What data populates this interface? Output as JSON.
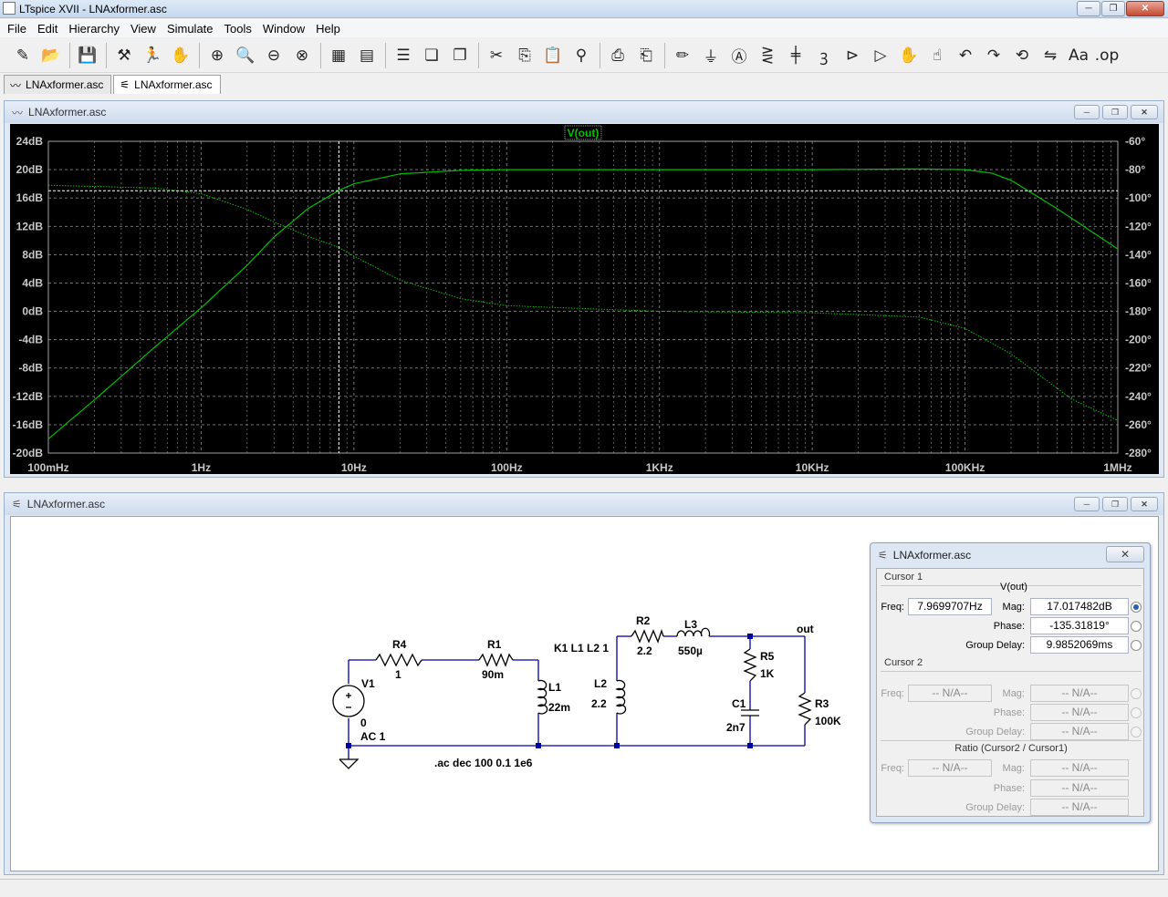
{
  "app": {
    "title": "LTspice XVII - LNAxformer.asc",
    "window_buttons": {
      "minimize": "─",
      "restore": "❐",
      "close": "✕"
    }
  },
  "menu": [
    "File",
    "Edit",
    "Hierarchy",
    "View",
    "Simulate",
    "Tools",
    "Window",
    "Help"
  ],
  "toolbar": [
    {
      "name": "new-schematic-icon",
      "glyph": "✎"
    },
    {
      "name": "open-icon",
      "glyph": "📂"
    },
    {
      "sep": true
    },
    {
      "name": "save-icon",
      "glyph": "💾"
    },
    {
      "sep": true
    },
    {
      "name": "control-panel-icon",
      "glyph": "⚒"
    },
    {
      "name": "run-icon",
      "glyph": "🏃"
    },
    {
      "name": "halt-icon",
      "glyph": "✋"
    },
    {
      "sep": true
    },
    {
      "name": "zoom-in-icon",
      "glyph": "⊕"
    },
    {
      "name": "pan-icon",
      "glyph": "🔍"
    },
    {
      "name": "zoom-out-icon",
      "glyph": "⊖"
    },
    {
      "name": "zoom-fit-icon",
      "glyph": "⊗"
    },
    {
      "sep": true
    },
    {
      "name": "autorange-icon",
      "glyph": "▦"
    },
    {
      "name": "plot-settings-icon",
      "glyph": "▤"
    },
    {
      "sep": true
    },
    {
      "name": "tile-horizontal-icon",
      "glyph": "☰"
    },
    {
      "name": "tile-vertical-icon",
      "glyph": "❏"
    },
    {
      "name": "cascade-icon",
      "glyph": "❐"
    },
    {
      "sep": true
    },
    {
      "name": "cut-icon",
      "glyph": "✂"
    },
    {
      "name": "copy-icon",
      "glyph": "⎘"
    },
    {
      "name": "paste-icon",
      "glyph": "📋"
    },
    {
      "name": "find-icon",
      "glyph": "⚲"
    },
    {
      "sep": true
    },
    {
      "name": "print-icon",
      "glyph": "⎙"
    },
    {
      "name": "print-preview-icon",
      "glyph": "⎗"
    },
    {
      "sep": true
    },
    {
      "name": "wire-icon",
      "glyph": "✏"
    },
    {
      "name": "ground-icon",
      "glyph": "⏚"
    },
    {
      "name": "label-net-icon",
      "glyph": "Ⓐ"
    },
    {
      "name": "resistor-icon",
      "glyph": "⋛"
    },
    {
      "name": "capacitor-icon",
      "glyph": "╪"
    },
    {
      "name": "inductor-icon",
      "glyph": "ꝫ"
    },
    {
      "name": "diode-icon",
      "glyph": "⊳"
    },
    {
      "name": "component-icon",
      "glyph": "▷"
    },
    {
      "name": "move-icon",
      "glyph": "✋"
    },
    {
      "name": "drag-icon",
      "glyph": "☝"
    },
    {
      "name": "undo-icon",
      "glyph": "↶"
    },
    {
      "name": "redo-icon",
      "glyph": "↷"
    },
    {
      "name": "rotate-icon",
      "glyph": "⟲"
    },
    {
      "name": "mirror-icon",
      "glyph": "⇋"
    },
    {
      "name": "text-icon",
      "glyph": "Aa"
    },
    {
      "name": "spice-directive-icon",
      "glyph": ".op"
    }
  ],
  "tabs": [
    {
      "label": "LNAxformer.asc",
      "icon": "waveform-icon",
      "glyph": "〰",
      "active": false
    },
    {
      "label": "LNAxformer.asc",
      "icon": "schematic-icon",
      "glyph": "⚟",
      "active": true
    }
  ],
  "plot_window": {
    "title": "LNAxformer.asc",
    "trace_label": "V(out)",
    "trace_color": "#00c000",
    "grid_color": "#808080",
    "cursor_color": "#ffffff"
  },
  "chart_data": {
    "type": "line",
    "title": "V(out)",
    "x_scale": "log",
    "xlim": [
      0.1,
      1000000
    ],
    "x_ticks": [
      "100mHz",
      "1Hz",
      "10Hz",
      "100Hz",
      "1KHz",
      "10KHz",
      "100KHz",
      "1MHz"
    ],
    "y_left_ticks": [
      "24dB",
      "20dB",
      "16dB",
      "12dB",
      "8dB",
      "4dB",
      "0dB",
      "-4dB",
      "-8dB",
      "-12dB",
      "-16dB",
      "-20dB"
    ],
    "y_right_ticks": [
      "-60°",
      "-80°",
      "-100°",
      "-120°",
      "-140°",
      "-160°",
      "-180°",
      "-200°",
      "-220°",
      "-240°",
      "-260°",
      "-280°"
    ],
    "ylim_left": [
      -20,
      24
    ],
    "ylim_right": [
      -280,
      -60
    ],
    "grid": true,
    "series": [
      {
        "name": "V(out)",
        "axis": "magnitude",
        "x": [
          0.1,
          0.2,
          0.5,
          1,
          2,
          3,
          5,
          8,
          10,
          20,
          50,
          100,
          1000,
          10000,
          50000,
          100000,
          150000,
          200000,
          400000,
          1000000
        ],
        "y": [
          -18,
          -12.5,
          -5,
          0.5,
          6.5,
          10.5,
          14.5,
          17.1,
          18.0,
          19.4,
          19.9,
          20.0,
          20.0,
          20.0,
          20.1,
          20.0,
          19.5,
          18.5,
          14.5,
          8.8
        ]
      },
      {
        "name": "V(out) phase",
        "axis": "phase",
        "x": [
          0.1,
          0.5,
          1,
          2,
          3,
          5,
          8,
          10,
          20,
          50,
          100,
          1000,
          10000,
          50000,
          100000,
          200000,
          500000,
          1000000
        ],
        "y": [
          -91,
          -93,
          -97,
          -108,
          -117,
          -127,
          -135,
          -141,
          -158,
          -171,
          -176,
          -180,
          -181,
          -184,
          -192,
          -210,
          -242,
          -257
        ]
      }
    ],
    "cursor": {
      "x": 7.9699707,
      "y": 17.017482
    }
  },
  "schematic_window": {
    "title": "LNAxformer.asc",
    "labels": {
      "r4": "R4",
      "r4_val": "1",
      "r1": "R1",
      "r1_val": "90m",
      "v1": "V1",
      "v1_val": "0",
      "v1_ac": "AC 1",
      "l1": "L1",
      "l1_val": "22m",
      "k1": "K1 L1 L2 1",
      "l2": "L2",
      "l2_val": "2.2",
      "r2": "R2",
      "r2_val": "2.2",
      "l3": "L3",
      "l3_val": "550µ",
      "r5": "R5",
      "r5_val": "1K",
      "c1": "C1",
      "c1_val": "2n7",
      "r3": "R3",
      "r3_val": "100K",
      "out": "out",
      "directive": ".ac dec 100 0.1 1e6"
    },
    "wire_color": "#0000a0",
    "component_color": "#000000"
  },
  "cursor_dialog": {
    "title": "LNAxformer.asc",
    "close": "✕",
    "cursor1": {
      "group": "Cursor 1",
      "trace": "V(out)",
      "freq_label": "Freq:",
      "freq": "7.9699707Hz",
      "mag_label": "Mag:",
      "mag": "17.017482dB",
      "phase_label": "Phase:",
      "phase": "-135.31819°",
      "gd_label": "Group Delay:",
      "gd": "9.9852069ms"
    },
    "cursor2": {
      "group": "Cursor 2",
      "freq_label": "Freq:",
      "freq": "-- N/A--",
      "mag_label": "Mag:",
      "mag": "-- N/A--",
      "phase_label": "Phase:",
      "phase": "-- N/A--",
      "gd_label": "Group Delay:",
      "gd": "-- N/A--"
    },
    "ratio": {
      "group": "Ratio (Cursor2 / Cursor1)",
      "freq_label": "Freq:",
      "freq": "-- N/A--",
      "mag_label": "Mag:",
      "mag": "-- N/A--",
      "phase_label": "Phase:",
      "phase": "-- N/A--",
      "gd_label": "Group Delay:",
      "gd": "-- N/A--"
    }
  }
}
